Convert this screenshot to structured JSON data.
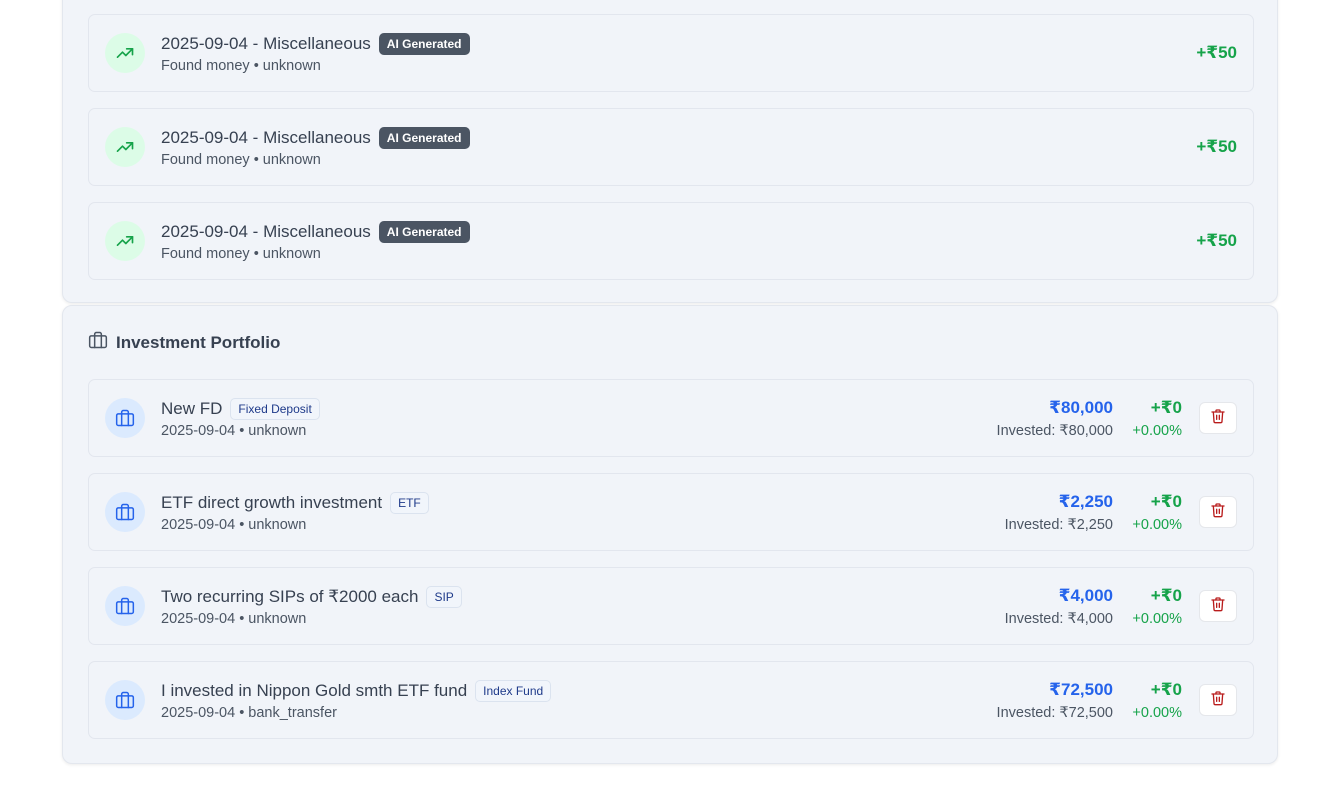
{
  "transactions": [
    {
      "title": "2025-09-04 - Miscellaneous",
      "badge": "AI Generated",
      "sub": "Found money • unknown",
      "amount": "+₹50",
      "icon": "trending-up-icon"
    },
    {
      "title": "2025-09-04 - Miscellaneous",
      "badge": "AI Generated",
      "sub": "Found money • unknown",
      "amount": "+₹50",
      "icon": "trending-up-icon"
    },
    {
      "title": "2025-09-04 - Miscellaneous",
      "badge": "AI Generated",
      "sub": "Found money • unknown",
      "amount": "+₹50",
      "icon": "trending-up-icon"
    }
  ],
  "portfolio": {
    "title": "Investment Portfolio",
    "icon": "briefcase-icon",
    "items": [
      {
        "name": "New FD",
        "type": "Fixed Deposit",
        "sub": "2025-09-04 • unknown",
        "value": "₹80,000",
        "invested": "Invested: ₹80,000",
        "gain": "+₹0",
        "pct": "+0.00%"
      },
      {
        "name": "ETF direct growth investment",
        "type": "ETF",
        "sub": "2025-09-04 • unknown",
        "value": "₹2,250",
        "invested": "Invested: ₹2,250",
        "gain": "+₹0",
        "pct": "+0.00%"
      },
      {
        "name": "Two recurring SIPs of ₹2000 each",
        "type": "SIP",
        "sub": "2025-09-04 • unknown",
        "value": "₹4,000",
        "invested": "Invested: ₹4,000",
        "gain": "+₹0",
        "pct": "+0.00%"
      },
      {
        "name": "I invested in Nippon Gold smth ETF fund",
        "type": "Index Fund",
        "sub": "2025-09-04 • bank_transfer",
        "value": "₹72,500",
        "invested": "Invested: ₹72,500",
        "gain": "+₹0",
        "pct": "+0.00%"
      }
    ]
  },
  "colors": {
    "positive": "#16a34a",
    "value": "#2563eb",
    "delete": "#b91c1c",
    "ai_badge": "#4b5563"
  }
}
